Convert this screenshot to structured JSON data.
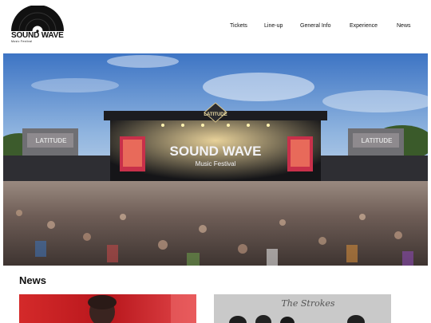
{
  "brand": {
    "name": "SOUND WAVE",
    "tagline": "Music Festival"
  },
  "nav": {
    "items": [
      {
        "label": "Tickets"
      },
      {
        "label": "Line-up"
      },
      {
        "label": "General Info"
      },
      {
        "label": "Experience"
      },
      {
        "label": "News"
      }
    ]
  },
  "hero": {
    "stage_title": "SOUND WAVE",
    "stage_subtitle": "Music Festival",
    "stage_sign": "LATITUDE",
    "side_screen_left": "LATITUDE",
    "side_screen_right": "LATITUDE",
    "colors": {
      "sky_top": "#3f78c8",
      "sky_bottom": "#a9c8e8",
      "crowd": "#6b5548"
    }
  },
  "news": {
    "heading": "News",
    "cards": [
      {
        "title": "",
        "image": "artist-photo"
      },
      {
        "title": "The Strokes",
        "image": "band-photo"
      }
    ]
  }
}
